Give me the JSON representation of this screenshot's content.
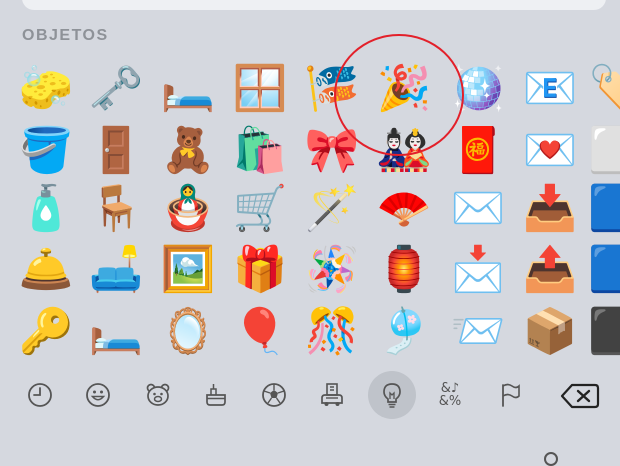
{
  "section_title": "OBJETOS",
  "emoji_rows": [
    [
      "🧽",
      "🗝️",
      "🛏️",
      "🪟",
      "🎏",
      "🎉",
      "🪩",
      "📧",
      "🏷️"
    ],
    [
      "🪣",
      "🚪",
      "🧸",
      "🛍️",
      "🎀",
      "🎎",
      "🧧",
      "💌",
      "⬜"
    ],
    [
      "🧴",
      "🪑",
      "🪆",
      "🛒",
      "🪄",
      "🪭",
      "✉️",
      "📥",
      "🟦"
    ],
    [
      "🛎️",
      "🛋️",
      "🖼️",
      "🎁",
      "🪅",
      "🏮",
      "📩",
      "📤",
      "🟦"
    ],
    [
      "🔑",
      "🛏️",
      "🪞",
      "🎈",
      "🎊",
      "🎐",
      "📨",
      "📦",
      "⬛"
    ]
  ],
  "highlighted_emoji": "🎉",
  "category_bar": {
    "items": [
      {
        "icon": "clock-icon",
        "name": "recent"
      },
      {
        "icon": "smiley-icon",
        "name": "smileys"
      },
      {
        "icon": "bear-icon",
        "name": "animals"
      },
      {
        "icon": "food-icon",
        "name": "food"
      },
      {
        "icon": "ball-icon",
        "name": "activities"
      },
      {
        "icon": "building-icon",
        "name": "travel"
      },
      {
        "icon": "lightbulb-icon",
        "name": "objects"
      },
      {
        "icon": "symbols-icon",
        "name": "symbols"
      },
      {
        "icon": "flag-icon",
        "name": "flags"
      }
    ],
    "active": "objects",
    "symbols_text_top": "&♪",
    "symbols_text_bottom": "&%"
  },
  "colors": {
    "background": "#d5d8df",
    "accent_circle": "#e3202a",
    "icon": "#555555",
    "active_pill": "#bfc3ca"
  }
}
